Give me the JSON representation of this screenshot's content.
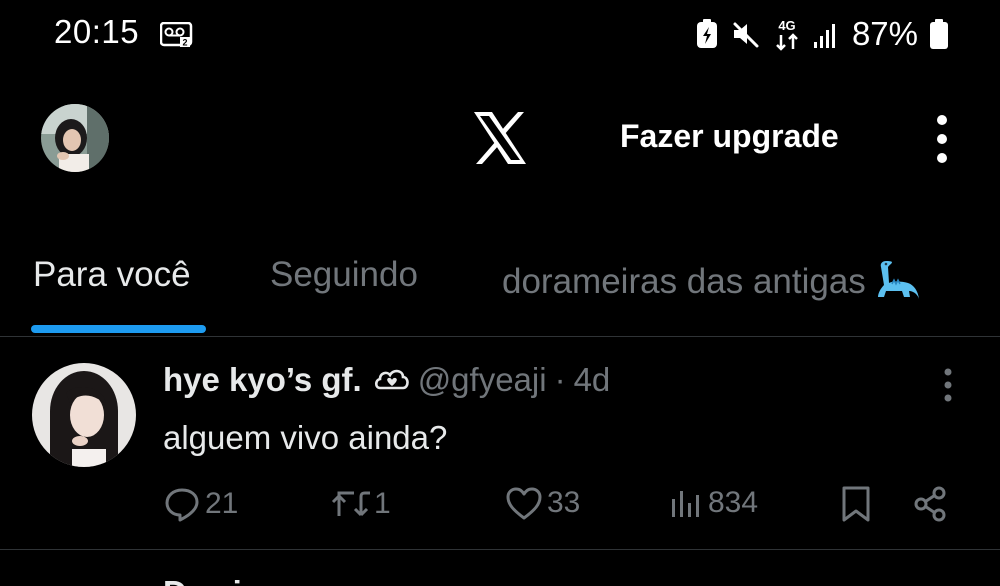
{
  "status_bar": {
    "time": "20:15",
    "battery_percent": "87%",
    "network": "4G",
    "icons": [
      "voicemail-icon",
      "battery-saver-icon",
      "mute-icon",
      "network-4g-icon",
      "signal-icon",
      "battery-icon"
    ]
  },
  "header": {
    "logo": "x-logo-icon",
    "upgrade_label": "Fazer upgrade",
    "menu_icon": "more-vertical-icon"
  },
  "tabs": [
    {
      "label": "Para você",
      "active": true
    },
    {
      "label": "Seguindo",
      "active": false
    },
    {
      "label": "dorameiras das antigas",
      "active": false,
      "emoji": "dinosaur-emoji"
    }
  ],
  "colors": {
    "background": "#000000",
    "text_primary": "#e7e9ea",
    "text_secondary": "#71767b",
    "accent": "#1d9bf0",
    "divider": "#2f3336"
  },
  "tweet": {
    "display_name": "hye kyo’s gf.",
    "name_emoji": "cloud-heart-icon",
    "handle": "@gfyeaji",
    "separator": "·",
    "time": "4d",
    "text": "alguem vivo ainda?",
    "actions": {
      "replies": "21",
      "retweets": "1",
      "likes": "33",
      "views": "834"
    }
  },
  "next_tweet": {
    "display_name": "Dorri"
  }
}
